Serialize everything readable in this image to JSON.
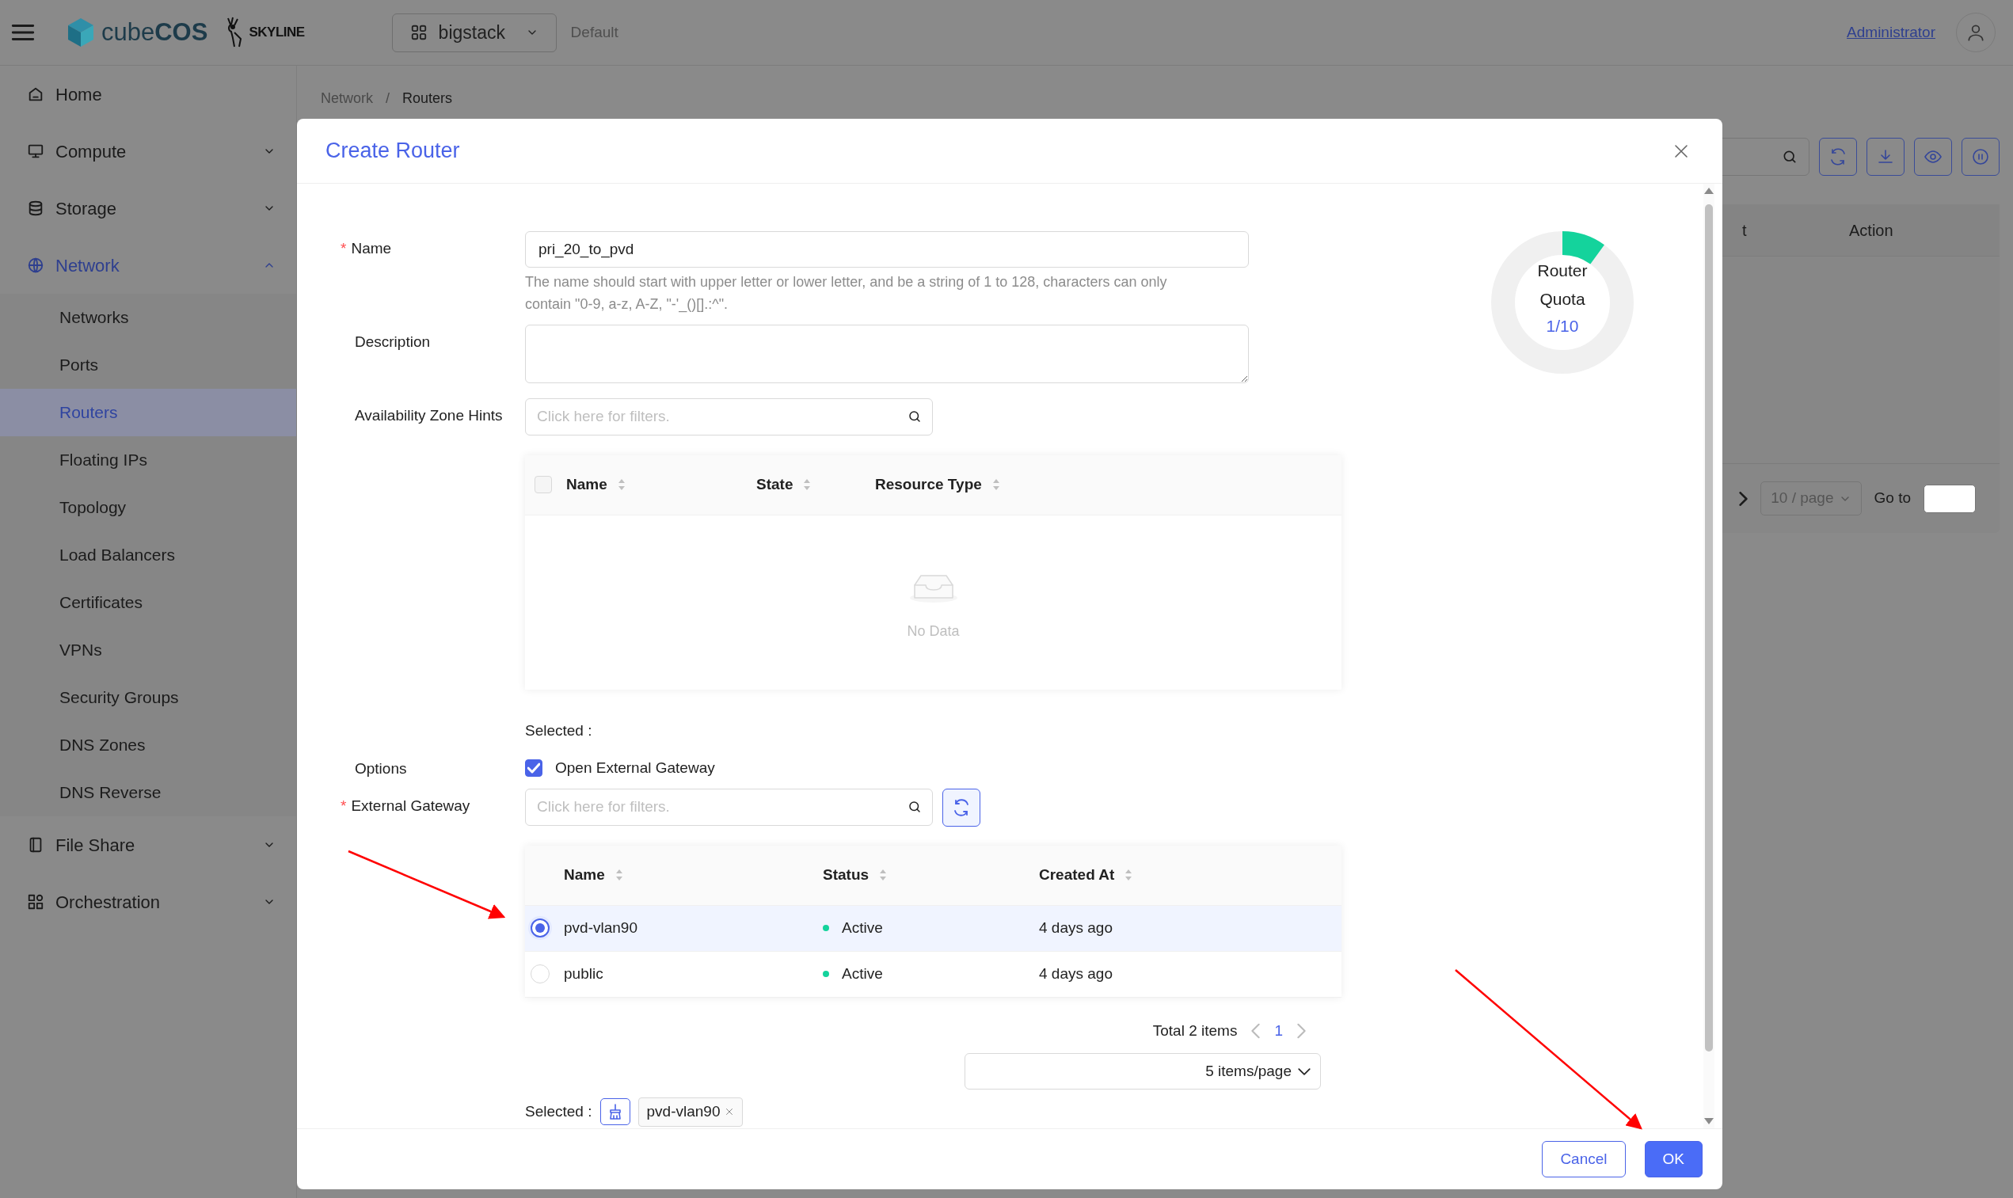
{
  "header": {
    "brand": "cube**COS**",
    "brand2": "SKYLINE",
    "project": "bigstack",
    "domain": "Default",
    "user": "Administrator"
  },
  "sidebar": {
    "items": [
      {
        "label": "Home",
        "selected": false
      },
      {
        "label": "Compute",
        "selected": false,
        "expanded": false
      },
      {
        "label": "Storage",
        "selected": false,
        "expanded": false
      },
      {
        "label": "Network",
        "selected": true,
        "expanded": true,
        "children": [
          {
            "label": "Networks",
            "selected": false
          },
          {
            "label": "Ports",
            "selected": false
          },
          {
            "label": "Routers",
            "selected": true
          },
          {
            "label": "Floating IPs",
            "selected": false
          },
          {
            "label": "Topology",
            "selected": false
          },
          {
            "label": "Load Balancers",
            "selected": false
          },
          {
            "label": "Certificates",
            "selected": false
          },
          {
            "label": "VPNs",
            "selected": false
          },
          {
            "label": "Security Groups",
            "selected": false
          },
          {
            "label": "DNS Zones",
            "selected": false
          },
          {
            "label": "DNS Reverse",
            "selected": false
          }
        ]
      },
      {
        "label": "File Share",
        "selected": false,
        "expanded": false
      },
      {
        "label": "Orchestration",
        "selected": false,
        "expanded": false
      }
    ]
  },
  "breadcrumb": {
    "items": [
      "Network",
      "Routers"
    ],
    "separator": "/"
  },
  "background_page": {
    "table_columns": [
      "t",
      "Action"
    ],
    "page_size": "10 / page",
    "goto_label": "Go to"
  },
  "modal": {
    "title": "Create Router",
    "required_mark": "*",
    "name": {
      "label": "Name",
      "required": true,
      "value": "pri_20_to_pvd",
      "help": "The name should start with upper letter or lower letter, and be a string of 1 to 128, characters can only contain \"0-9, a-z, A-Z, \"-'_()[].:^\"."
    },
    "description": {
      "label": "Description",
      "required": false
    },
    "availability_zone": {
      "label": "Availability Zone Hints",
      "required": false,
      "placeholder": "Click here for filters.",
      "header_checked": false,
      "columns": [
        "Name",
        "State",
        "Resource Type"
      ],
      "empty_text": "No Data",
      "selected_label": "Selected :"
    },
    "options": {
      "label": "Options",
      "checkbox": {
        "label": "Open External Gateway",
        "checked": true
      }
    },
    "external_gateway": {
      "label": "External Gateway",
      "required": true,
      "placeholder": "Click here for filters.",
      "columns": [
        "Name",
        "Status",
        "Created At"
      ],
      "rows": [
        {
          "name": "pvd-vlan90",
          "status": "Active",
          "created_at": "4 days ago",
          "selected": true
        },
        {
          "name": "public",
          "status": "Active",
          "created_at": "4 days ago",
          "selected": false
        }
      ],
      "total": "Total 2 items",
      "page": "1",
      "page_size": "5 items/page",
      "selected_label": "Selected :",
      "selected_tags": [
        "pvd-vlan90"
      ]
    },
    "quota": {
      "title": "Router Quota",
      "value": "1/10",
      "level": 0.1
    },
    "buttons": [
      {
        "label": "Cancel",
        "primary": false
      },
      {
        "label": "OK",
        "primary": true
      }
    ]
  }
}
